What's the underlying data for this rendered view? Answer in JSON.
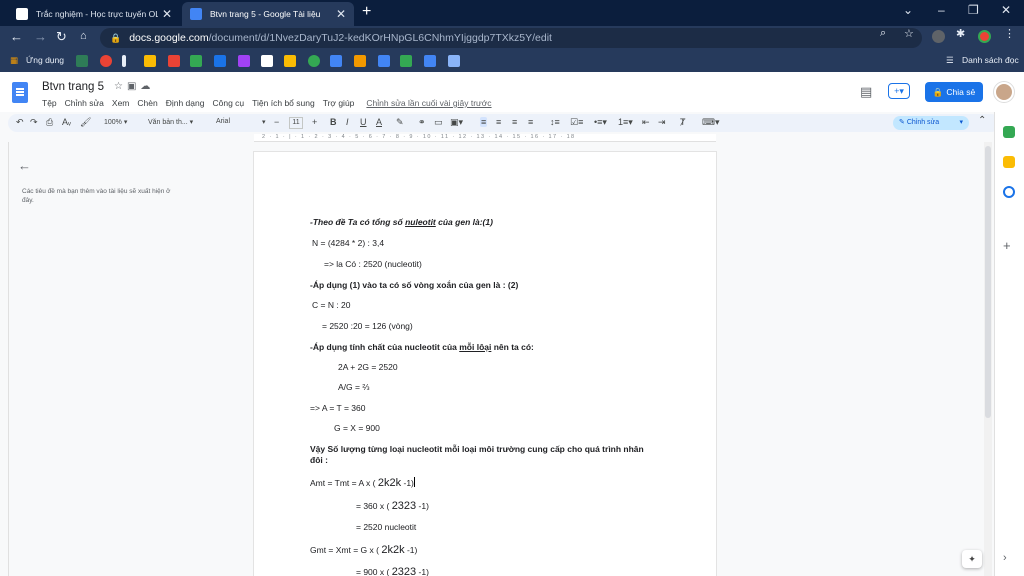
{
  "browser": {
    "tabs": [
      {
        "title": "Trắc nghiệm - Học trực tuyến OLM",
        "fav_color": "#ffffff"
      },
      {
        "title": "Btvn trang 5 - Google Tài liệu",
        "fav_color": "#4285f4"
      }
    ],
    "new_tab": "+",
    "window_buttons": [
      "⌄",
      "–",
      "❐",
      "✕"
    ],
    "url_host": "docs.google.com",
    "url_path": "/document/d/1NvezDaryTuJ2-kedKOrHNpGL6CNhmYIjggdp7TXkz5Y/edit",
    "bookmarks_apps": "Ứng dụng",
    "reading_list": "Danh sách đọc",
    "ext_colors": [
      "#f29900",
      "#ea4335",
      "#ea4335",
      "#34a853",
      "#fbbc04",
      "#1a73e8",
      "#a142f4",
      "#ffffff",
      "#fbbc04",
      "#34a853",
      "#4285f4",
      "#f29900",
      "#ea4335",
      "#9aa0a6",
      "#fbbc04",
      "#24c1e0",
      "#4285f4",
      "#8ab4f8"
    ]
  },
  "docs": {
    "title": "Btvn trang 5",
    "menu": [
      "Tệp",
      "Chỉnh sửa",
      "Xem",
      "Chèn",
      "Định dạng",
      "Công cụ",
      "Tiện ích bổ sung",
      "Trợ giúp"
    ],
    "last_edit": "Chỉnh sửa lần cuối vài giây trước",
    "share_label": "Chia sẻ",
    "toolbar": {
      "zoom": "100%",
      "style": "Văn bản th...",
      "font": "Arial",
      "size": "11",
      "editing": "Chỉnh sửa"
    },
    "ruler": "2 · 1 · | · 1 · 2 · 3 · 4 · 5 · 6 · 7 · 8 · 9 · 10 · 11 · 12 · 13 · 14 · 15 · 16 · 17 · 18",
    "outline_hint": "Các tiêu đề mà bạn thêm vào tài liệu sẽ xuất hiện ở đây."
  },
  "content": {
    "l1_pre": "-Theo đề Ta có tổng số ",
    "l1_u": "nuleotit",
    "l1_post": " của gen là:(1)",
    "l2": "N = (4284 * 2) : 3,4",
    "l3": "=> la Có : 2520 (nucleotit)",
    "l4": "-Áp dụng (1) vào ta có số vòng xoắn của gen là : (2)",
    "l5": "C = N : 20",
    "l6": "= 2520 :20 = 126 (vòng)",
    "l7_pre": "-Áp dụng tính chất của nucleotit của ",
    "l7_u": "mỗi lôại",
    "l7_post": " nên ta có:",
    "l8": "2A + 2G = 2520",
    "l9": "A/G = ⅔",
    "l10": "=>     A = T = 360",
    "l11": "G = X = 900",
    "l12a": "Vậy Số lượng từng loại nucleotit mỗi loại môi trường cung cấp cho quá trình nhân",
    "l12b": "đôi :",
    "l13_pre": "Amt = Tmt = A x ( ",
    "l13_big": "2k2k",
    "l13_post": " -1)",
    "l14_pre": "= 360 x ( ",
    "l14_big": "2323",
    "l14_post": " -1)",
    "l15": "= 2520 nucleotit",
    "l16_pre": "Gmt = Xmt = G x ( ",
    "l16_big": "2k2k",
    "l16_post": " -1)",
    "l17_pre": "= 900 x ( ",
    "l17_big": "2323",
    "l17_post": " -1)"
  }
}
